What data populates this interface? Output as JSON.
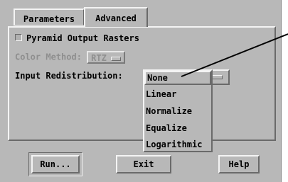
{
  "tabs": [
    {
      "label": "Parameters"
    },
    {
      "label": "Advanced"
    }
  ],
  "advanced": {
    "pyramid_checkbox_label": "Pyramid Output Rasters",
    "pyramid_checked": false,
    "color_method_label": "Color Method:",
    "color_method_value": "RTZ",
    "input_redistribution_label": "Input Redistribution:",
    "input_redistribution_value": "None"
  },
  "redistribution_menu": {
    "options": [
      "None",
      "Linear",
      "Normalize",
      "Equalize",
      "Logarithmic"
    ]
  },
  "buttons": {
    "run": "Run...",
    "exit": "Exit",
    "help": "Help"
  },
  "colors": {
    "panel": "#b8b8b8",
    "disabled_text": "#8e8e8e"
  }
}
